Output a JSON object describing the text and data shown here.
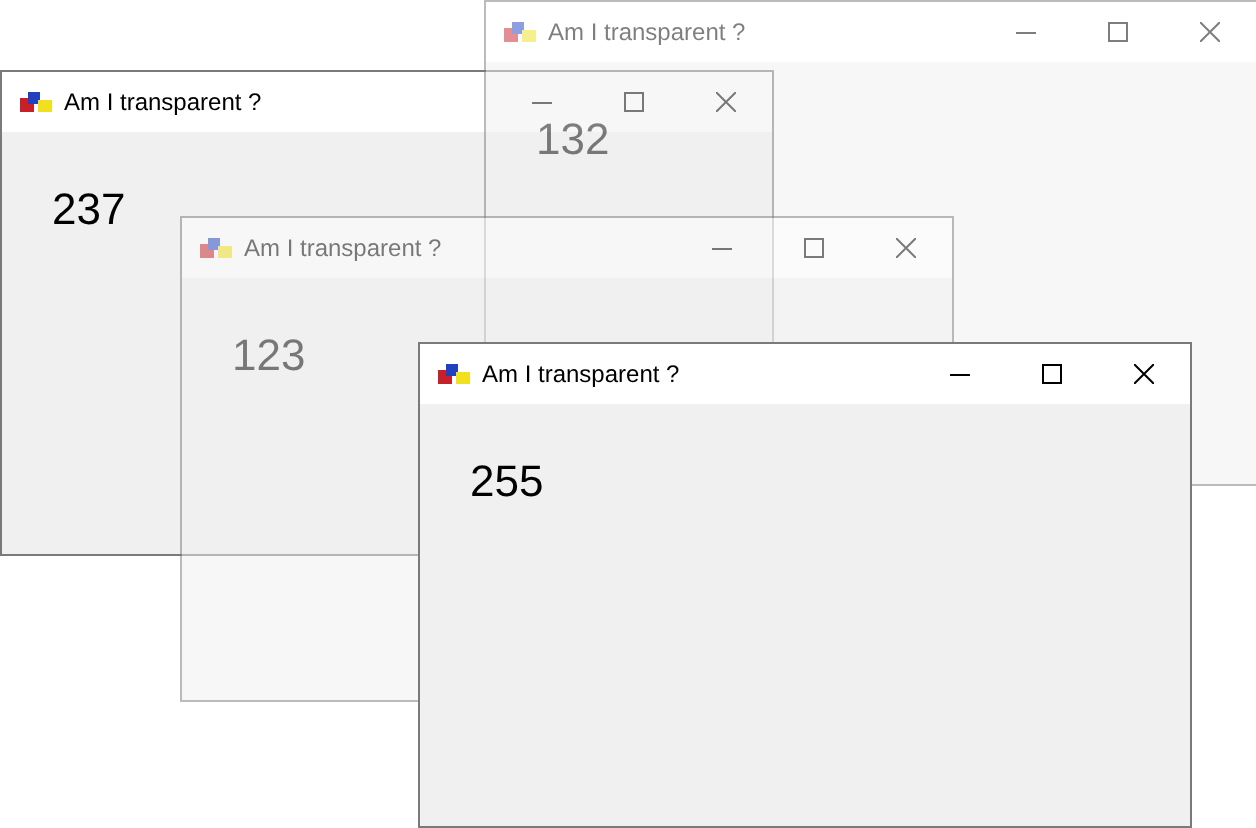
{
  "windows": [
    {
      "title": "Am I transparent ?",
      "value": "237",
      "translucent": false
    },
    {
      "title": "Am I transparent ?",
      "value": "132",
      "translucent": true
    },
    {
      "title": "Am I transparent ?",
      "value": "123",
      "translucent": true
    },
    {
      "title": "Am I transparent ?",
      "value": "255",
      "translucent": false
    }
  ]
}
